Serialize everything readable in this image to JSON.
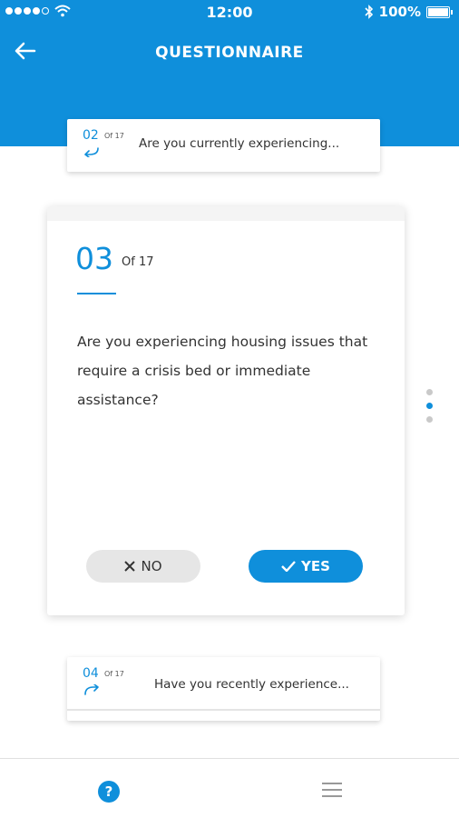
{
  "status_bar": {
    "time": "12:00",
    "battery": "100%"
  },
  "header": {
    "title": "QUESTIONNAIRE"
  },
  "previous_question": {
    "number": "02",
    "of": "Of 17",
    "text": "Are you currently experiencing..."
  },
  "current_question": {
    "number": "03",
    "of": "Of 17",
    "text": "Are you experiencing housing issues that require a crisis bed or immediate assistance?",
    "no_label": "NO",
    "yes_label": "YES"
  },
  "next_question": {
    "number": "04",
    "of": "Of 17",
    "text": "Have you recently experience..."
  },
  "pager": {
    "total_dots": 3,
    "active_dot": 2
  },
  "tabbar": {
    "help_glyph": "?"
  },
  "colors": {
    "primary": "#0f8fdb",
    "no_button": "#e6e6e6"
  },
  "icons": [
    "back-arrow-icon",
    "return-arrow-icon",
    "forward-arrow-icon",
    "close-icon",
    "check-icon",
    "help-icon",
    "menu-icon",
    "wifi-icon",
    "bluetooth-icon",
    "battery-icon"
  ]
}
